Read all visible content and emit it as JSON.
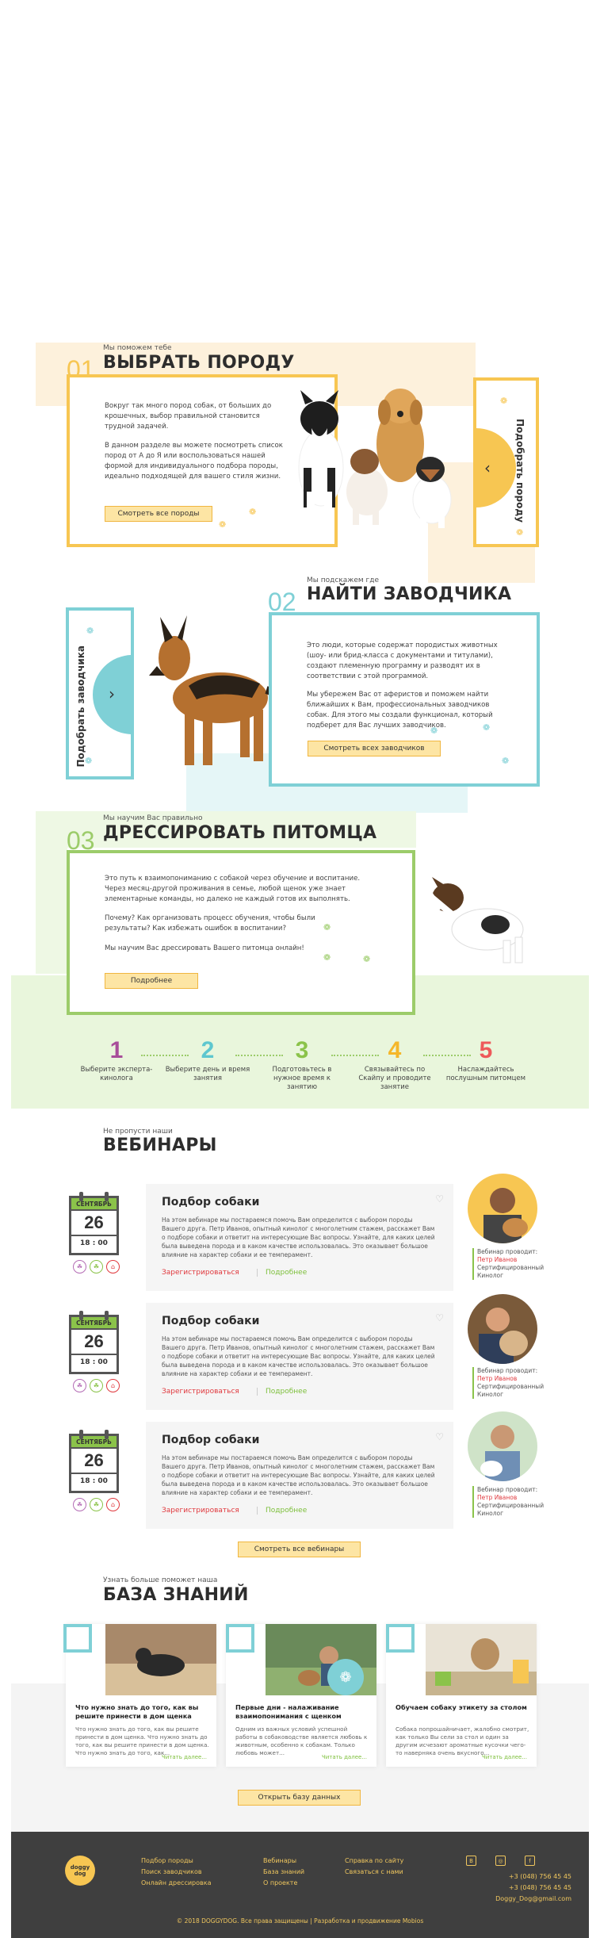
{
  "section1": {
    "num": "01",
    "kicker": "Мы поможем тебе",
    "title": "ВЫБРАТЬ ПОРОДУ",
    "para1": "Вокруг так много пород собак, от больших до крошечных, выбор правильной становится трудной задачей.",
    "para2": "В данном разделе вы можете посмотреть список пород от А до Я или воспользоваться нашей формой для индивидуального подбора породы, идеально подходящей для вашего стиля жизни.",
    "button": "Смотреть все породы",
    "side_label": "Подобрать породу"
  },
  "section2": {
    "num": "02",
    "kicker": "Мы подскажем где",
    "title": "НАЙТИ ЗАВОДЧИКА",
    "para1": "Это люди, которые содержат породистых животных (шоу- или брид-класса с документами и титулами), создают племенную программу и разводят их в соответствии с этой программой.",
    "para2": "Мы убережем Вас от аферистов и поможем найти ближайших к Вам, профессиональных заводчиков собак. Для этого мы создали функционал, который подберет для Вас лучших заводчиков.",
    "button": "Смотреть всех заводчиков",
    "side_label": "Подобрать заводчика"
  },
  "section3": {
    "num": "03",
    "kicker": "Мы научим Вас правильно",
    "title": "ДРЕССИРОВАТЬ ПИТОМЦА",
    "para1": "Это путь к взаимопониманию с собакой через обучение и воспитание. Через месяц-другой проживания в семье, любой щенок уже знает элементарные команды, но далеко не каждый готов их выполнять.",
    "para2": "Почему? Как организовать процесс обучения, чтобы были результаты? Как избежать ошибок в воспитании?",
    "para3": "Мы научим Вас дрессировать Вашего питомца онлайн!",
    "button": "Подробнее"
  },
  "steps": [
    {
      "num": "1",
      "label": "Выберите эксперта-кинолога",
      "color": "#a84e9a"
    },
    {
      "num": "2",
      "label": "Выберите день и время занятия",
      "color": "#5ec7cf"
    },
    {
      "num": "3",
      "label": "Подготовьтесь в нужное время к занятию",
      "color": "#8bc34a"
    },
    {
      "num": "4",
      "label": "Связывайтесь по Скайпу и проводите занятие",
      "color": "#f5b72a"
    },
    {
      "num": "5",
      "label": "Наслаждайтесь послушным питомцем",
      "color": "#ee5a5a"
    }
  ],
  "webinars": {
    "kicker": "Не пропусти наши",
    "title": "ВЕБИНАРЫ",
    "items": [
      {
        "month": "СЕНТЯБРЬ",
        "day": "26",
        "time": "18 : 00",
        "title": "Подбор собаки",
        "desc": "На этом вебинаре мы постараемся помочь Вам определится с выбором породы Вашего друга. Петр Иванов, опытный кинолог с многолетним стажем, расскажет Вам о подборе собаки и ответит на интересующие Вас вопросы. Узнайте, для каких целей была выведена порода и в каком качестве использовалась. Это оказывает большое влияние на характер собаки и ее темперамент.",
        "register": "Зарегистрироваться",
        "more": "Подробнее",
        "speaker_lbl": "Вебинар проводит:",
        "speaker": "Петр Иванов",
        "speaker_role": "Сертифицированный Кинолог"
      },
      {
        "month": "СЕНТЯБРЬ",
        "day": "26",
        "time": "18 : 00",
        "title": "Подбор собаки",
        "desc": "На этом вебинаре мы постараемся помочь Вам определится с выбором породы Вашего друга. Петр Иванов, опытный кинолог с многолетним стажем, расскажет Вам о подборе собаки и ответит на интересующие Вас вопросы. Узнайте, для каких целей была выведена порода и в каком качестве использовалась. Это оказывает большое влияние на характер собаки и ее темперамент.",
        "register": "Зарегистрироваться",
        "more": "Подробнее",
        "speaker_lbl": "Вебинар проводит:",
        "speaker": "Петр Иванов",
        "speaker_role": "Сертифицированный Кинолог"
      },
      {
        "month": "СЕНТЯБРЬ",
        "day": "26",
        "time": "18 : 00",
        "title": "Подбор собаки",
        "desc": "На этом вебинаре мы постараемся помочь Вам определится с выбором породы Вашего друга. Петр Иванов, опытный кинолог с многолетним стажем, расскажет Вам о подборе собаки и ответит на интересующие Вас вопросы. Узнайте, для каких целей была выведена порода и в каком качестве использовалась. Это оказывает большое влияние на характер собаки и ее темперамент.",
        "register": "Зарегистрироваться",
        "more": "Подробнее",
        "speaker_lbl": "Вебинар проводит:",
        "speaker": "Петр Иванов",
        "speaker_role": "Сертифицированный Кинолог"
      }
    ],
    "all_button": "Смотреть все вебинары"
  },
  "knowledge": {
    "kicker": "Узнать больше поможет наша",
    "title": "БАЗА ЗНАНИЙ",
    "cards": [
      {
        "title": "Что нужно знать до того, как вы решите принести в дом щенка",
        "desc": "Что нужно знать до того, как вы решите принести в дом щенка. Что нужно знать до того, как вы решите принести в дом щенка. Что нужно знать до того, как...",
        "more": "Читать далее..."
      },
      {
        "title": "Первые дни - налаживание взаимопонимания с щенком",
        "desc": "Одним из важных условий успешной работы в собаководстве является любовь к животным, особенно к собакам. Только любовь может...",
        "more": "Читать далее..."
      },
      {
        "title": "Обучаем собаку этикету за столом",
        "desc": "Собака попрошайничает, жалобно смотрит, как только Вы сели за стол и один за другим исчезают ароматные кусочки чего-то наверняка очень вкусного...",
        "more": "Читать далее..."
      }
    ],
    "button": "Открыть базу данных"
  },
  "footer": {
    "logo": "doggy dog",
    "col1": [
      "Подбор породы",
      "Поиск заводчиков",
      "Онлайн дрессировка"
    ],
    "col2": [
      "Вебинары",
      "База знаний",
      "О проекте"
    ],
    "col3": [
      "Справка по сайту",
      "Связаться с нами"
    ],
    "phone1": "+3 (048) 756 45 45",
    "phone2": "+3 (048) 756 45 45",
    "email": "Doggy_Dog@gmail.com",
    "copyright": "© 2018 DOGGYDOG. Все права защищены | Разработка и продвижение Mobios"
  },
  "colors": {
    "yellow": "#f7c652",
    "teal": "#7fd0d6",
    "green": "#9ccc6a",
    "red": "#e0393e"
  }
}
